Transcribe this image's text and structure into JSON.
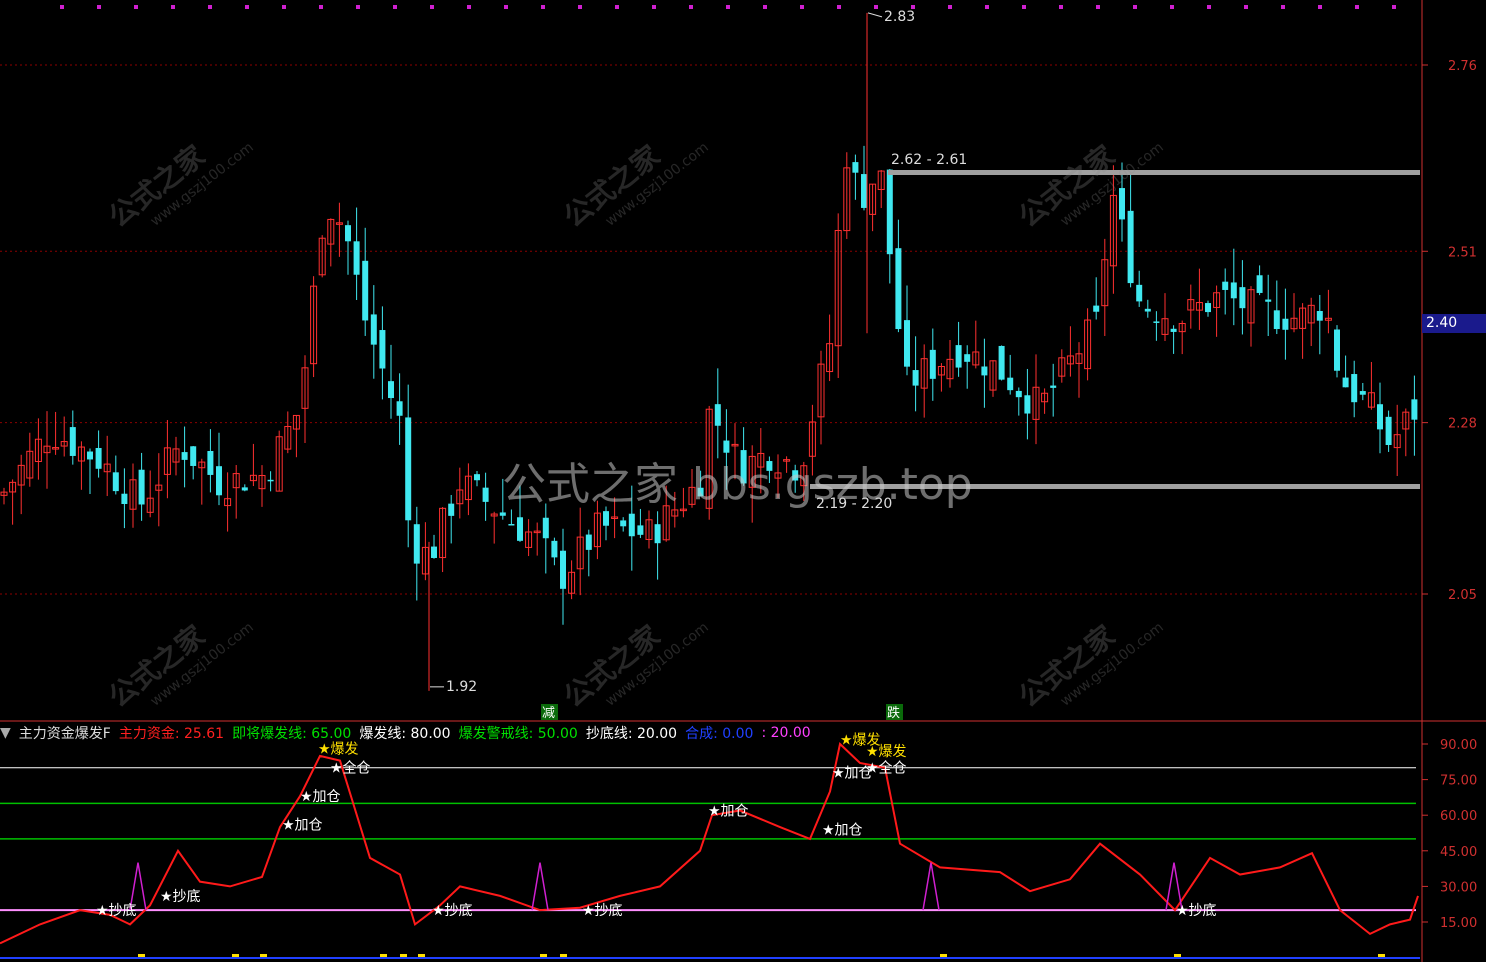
{
  "price_axis": {
    "ticks": [
      {
        "label": "2.76",
        "value": 2.76
      },
      {
        "label": "2.51",
        "value": 2.51
      },
      {
        "label": "2.28",
        "value": 2.28
      },
      {
        "label": "2.05",
        "value": 2.05
      }
    ],
    "current_price": "2.40"
  },
  "annotations": {
    "high_label": "2.83",
    "low_label": "1.92",
    "resistance_label": "2.62 - 2.61",
    "support_label": "2.19 - 2.20",
    "signal_jian": "减",
    "signal_die": "跌"
  },
  "watermark": {
    "center": "公式之家 bbs.gszb.top",
    "stamp_cn": "公式之家",
    "stamp_url": "www.gszj100.com"
  },
  "indicator": {
    "name": "主力资金爆发F",
    "fields": [
      {
        "label": "主力资金: 25.61",
        "color": "#ff2020"
      },
      {
        "label": "即将爆发线: 65.00",
        "color": "#00e000"
      },
      {
        "label": "爆发线: 80.00",
        "color": "#ffffff"
      },
      {
        "label": "爆发警戒线: 50.00",
        "color": "#00e000"
      },
      {
        "label": "抄底线: 20.00",
        "color": "#ffffff"
      },
      {
        "label": "合成: 0.00",
        "color": "#2040ff"
      },
      {
        "label": ": 20.00",
        "color": "#ff40ff"
      }
    ],
    "axis_ticks": [
      {
        "label": "90.00",
        "value": 90
      },
      {
        "label": "75.00",
        "value": 75
      },
      {
        "label": "60.00",
        "value": 60
      },
      {
        "label": "45.00",
        "value": 45
      },
      {
        "label": "30.00",
        "value": 30
      },
      {
        "label": "15.00",
        "value": 15
      }
    ],
    "signals": {
      "chaodi": "抄底",
      "jiacang": "加仓",
      "baofa": "爆发",
      "quancang": "全仓"
    }
  },
  "colors": {
    "up": "#ff3030",
    "down": "#40e8f0",
    "grid": "#8b0000",
    "axis": "#d03030"
  }
}
